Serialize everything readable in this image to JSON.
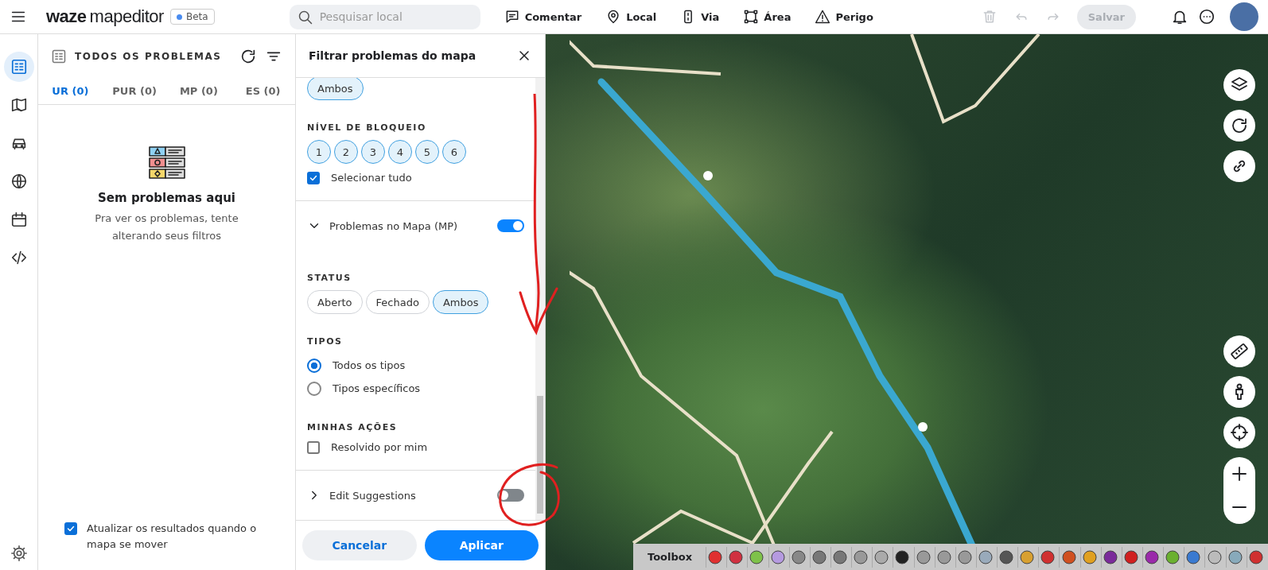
{
  "topbar": {
    "logo_bold": "waze",
    "logo_light": "mapeditor",
    "badge": "Beta",
    "search": {
      "placeholder": "Pesquisar local"
    },
    "tools": [
      {
        "kind": "comment",
        "label": "Comentar"
      },
      {
        "kind": "place",
        "label": "Local"
      },
      {
        "kind": "road",
        "label": "Via"
      },
      {
        "kind": "area",
        "label": "Área"
      },
      {
        "kind": "hazard",
        "label": "Perigo"
      }
    ],
    "save_button": {
      "label": "Salvar",
      "disabled": true
    }
  },
  "rail": {
    "items": [
      {
        "kind": "list",
        "selected": true
      },
      {
        "kind": "map",
        "selected": false
      },
      {
        "kind": "car",
        "selected": false
      },
      {
        "kind": "globe",
        "selected": false
      },
      {
        "kind": "calendar",
        "selected": false
      },
      {
        "kind": "code",
        "selected": false
      }
    ]
  },
  "issues_panel": {
    "title": "TODOS OS PROBLEMAS",
    "tabs": [
      {
        "label": "UR (0)",
        "selected": true
      },
      {
        "label": "PUR (0)",
        "selected": false
      },
      {
        "label": "MP (0)",
        "selected": false
      },
      {
        "label": "ES (0)",
        "selected": false
      }
    ],
    "empty_title": "Sem problemas aqui",
    "empty_text": "Pra ver os problemas, tente alterando seus filtros",
    "auto_update": {
      "label": "Atualizar os resultados quando o mapa se mover",
      "checked": true
    }
  },
  "filter_panel": {
    "title": "Filtrar problemas do mapa",
    "sections": [
      {
        "kind": "chips",
        "chips": [
          {
            "label": "Ambos",
            "selected": true
          }
        ]
      },
      {
        "kind": "round_chips",
        "heading": "NÍVEL DE BLOQUEIO",
        "chips": [
          {
            "label": "1",
            "selected": true
          },
          {
            "label": "2",
            "selected": true
          },
          {
            "label": "3",
            "selected": true
          },
          {
            "label": "4",
            "selected": true
          },
          {
            "label": "5",
            "selected": true
          },
          {
            "label": "6",
            "selected": true
          }
        ]
      },
      {
        "kind": "checkbox",
        "label": "Selecionar tudo",
        "checked": true
      },
      {
        "kind": "group",
        "label": "Problemas no Mapa (MP)",
        "expanded": true,
        "on": true
      },
      {
        "kind": "chips",
        "heading": "STATUS",
        "chips": [
          {
            "label": "Aberto",
            "selected": false
          },
          {
            "label": "Fechado",
            "selected": false
          },
          {
            "label": "Ambos",
            "selected": true
          }
        ]
      },
      {
        "kind": "radios",
        "heading": "TIPOS",
        "options": [
          {
            "label": "Todos os tipos",
            "selected": true
          },
          {
            "label": "Tipos específicos",
            "selected": false
          }
        ]
      },
      {
        "kind": "checkbox",
        "heading": "MINHAS AÇÕES",
        "label": "Resolvido por mim",
        "checked": false
      },
      {
        "kind": "group",
        "label": "Edit Suggestions",
        "expanded": false,
        "on": false
      }
    ],
    "cancel_button": "Cancelar",
    "apply_button": "Aplicar"
  },
  "toolbox": {
    "title": "Toolbox"
  }
}
